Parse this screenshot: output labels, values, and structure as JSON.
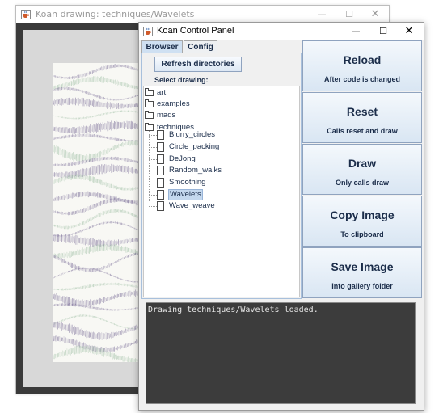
{
  "drawing_window": {
    "title": "Koan drawing: techniques/Wavelets",
    "icons": {
      "app": "java-cup-icon",
      "minimize": "minimize-icon",
      "maximize": "maximize-icon",
      "close": "close-icon"
    },
    "colors": {
      "frame": "#3a3a3a",
      "mat": "#d8d8d8",
      "paper": "#f8f8f4",
      "purple": "#5a4a80",
      "green": "#88b090"
    }
  },
  "control_panel": {
    "title": "Koan Control Panel",
    "tabs": [
      {
        "label": "Browser",
        "active": true
      },
      {
        "label": "Config",
        "active": false
      }
    ],
    "refresh_label": "Refresh directories",
    "select_label": "Select drawing:",
    "tree": [
      {
        "label": "art",
        "type": "folder"
      },
      {
        "label": "examples",
        "type": "folder"
      },
      {
        "label": "mads",
        "type": "folder"
      },
      {
        "label": "techniques",
        "type": "folder",
        "expanded": true
      },
      {
        "label": "Blurry_circles",
        "type": "file"
      },
      {
        "label": "Circle_packing",
        "type": "file"
      },
      {
        "label": "DeJong",
        "type": "file"
      },
      {
        "label": "Random_walks",
        "type": "file"
      },
      {
        "label": "Smoothing",
        "type": "file"
      },
      {
        "label": "Wavelets",
        "type": "file",
        "selected": true
      },
      {
        "label": "Wave_weave",
        "type": "file"
      }
    ],
    "buttons": [
      {
        "title": "Reload",
        "subtitle": "After code is changed"
      },
      {
        "title": "Reset",
        "subtitle": "Calls reset and draw"
      },
      {
        "title": "Draw",
        "subtitle": "Only calls draw"
      },
      {
        "title": "Copy Image",
        "subtitle": "To clipboard"
      },
      {
        "title": "Save Image",
        "subtitle": "Into gallery folder"
      }
    ],
    "console_text": "Drawing techniques/Wavelets loaded.",
    "colors": {
      "accent": "#1b2d4a",
      "selection": "#c4d8ee",
      "console_bg": "#3c3c3c",
      "console_text": "#e6e6e6"
    }
  }
}
